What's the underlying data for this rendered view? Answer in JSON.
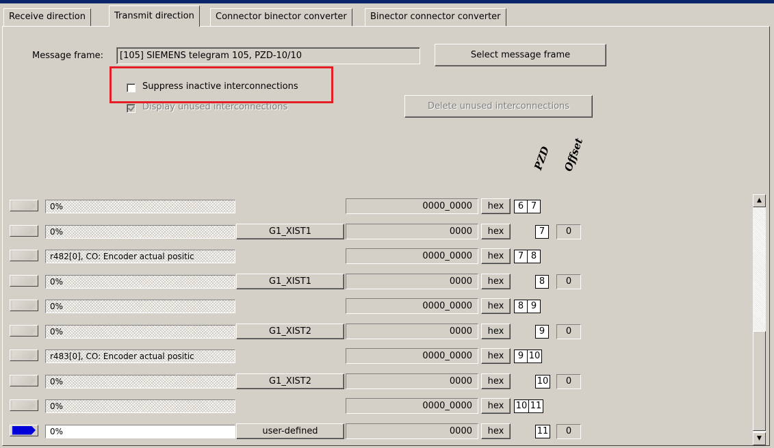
{
  "tabs": [
    {
      "label": "Receive direction"
    },
    {
      "label": "Transmit direction",
      "active": true
    },
    {
      "label": "Connector binector converter"
    },
    {
      "label": "Binector connector converter"
    }
  ],
  "message_frame": {
    "label": "Message frame:",
    "value": "[105] SIEMENS telegram 105, PZD-10/10",
    "select_button": "Select message frame"
  },
  "options": {
    "suppress_inactive": {
      "label": "Suppress inactive interconnections",
      "checked": false
    },
    "display_unused": {
      "label": "Display unused interconnections",
      "checked": true,
      "disabled": true
    },
    "delete_unused_button": "Delete unused interconnections"
  },
  "columns": {
    "pzd": "PZD",
    "offset": "Offset"
  },
  "highlight_color": "#e31e24",
  "rows": [
    {
      "source": "0%",
      "signal": "",
      "value": "0000_0000",
      "hex": "hex",
      "pzd": [
        "6",
        "7"
      ],
      "offset": ""
    },
    {
      "source": "0%",
      "signal": "G1_XIST1",
      "value": "0000",
      "hex": "hex",
      "pzd": [
        "7"
      ],
      "offset": "0"
    },
    {
      "source": "r482[0], CO: Encoder actual positic",
      "signal": "",
      "value": "0000_0000",
      "hex": "hex",
      "pzd": [
        "7",
        "8"
      ],
      "offset": ""
    },
    {
      "source": "0%",
      "signal": "G1_XIST1",
      "value": "0000",
      "hex": "hex",
      "pzd": [
        "8"
      ],
      "offset": "0"
    },
    {
      "source": "0%",
      "signal": "",
      "value": "0000_0000",
      "hex": "hex",
      "pzd": [
        "8",
        "9"
      ],
      "offset": ""
    },
    {
      "source": "0%",
      "signal": "G1_XIST2",
      "value": "0000",
      "hex": "hex",
      "pzd": [
        "9"
      ],
      "offset": "0"
    },
    {
      "source": "r483[0], CO: Encoder actual positic",
      "signal": "",
      "value": "0000_0000",
      "hex": "hex",
      "pzd": [
        "9",
        "10"
      ],
      "offset": ""
    },
    {
      "source": "0%",
      "signal": "G1_XIST2",
      "value": "0000",
      "hex": "hex",
      "pzd": [
        "10"
      ],
      "offset": "0"
    },
    {
      "source": "0%",
      "signal": "",
      "value": "0000_0000",
      "hex": "hex",
      "pzd": [
        "10",
        "11"
      ],
      "offset": ""
    },
    {
      "source": "0%",
      "signal": "user-defined",
      "value": "0000",
      "hex": "hex",
      "pzd": [
        "11"
      ],
      "offset": "0",
      "active": true
    }
  ],
  "scrollbar": {
    "up_icon": "scroll-up-arrow-icon",
    "down_icon": "scroll-down-arrow-icon"
  }
}
